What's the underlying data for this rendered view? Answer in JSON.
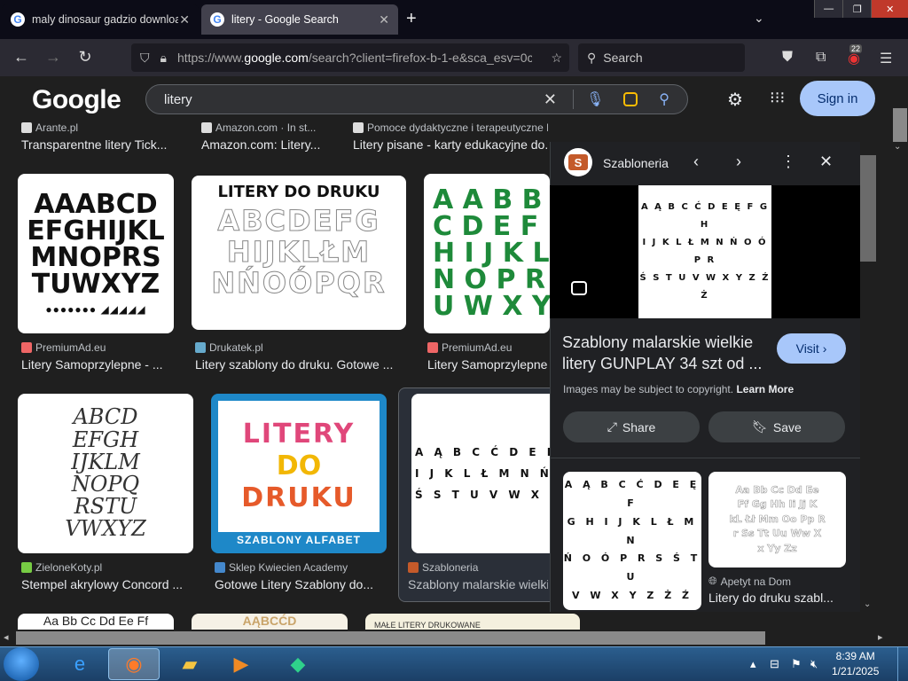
{
  "browser": {
    "tabs": [
      {
        "label": "maly dinosaur gadzio downloa",
        "active": false
      },
      {
        "label": "litery - Google Search",
        "active": true
      }
    ],
    "url_prefix": "https://www.",
    "url_domain": "google.com",
    "url_rest": "/search?client=firefox-b-1-e&sca_esv=0c",
    "search_placeholder": "Search",
    "badge": "22"
  },
  "google": {
    "logo": "Google",
    "query": "litery",
    "signin_label": "Sign in"
  },
  "top_row": [
    {
      "source": "Arante.pl",
      "title": "Transparentne litery Tick..."
    },
    {
      "source": "Amazon.com · In st...",
      "title": "Amazon.com: Litery..."
    },
    {
      "source": "Pomoce dydaktyczne i terapeutyczne By...",
      "title": "Litery pisane - karty edukacyjne do..."
    }
  ],
  "row1": [
    {
      "source": "PremiumAd.eu",
      "title": "Litery Samoprzylepne - ...",
      "art": [
        "AAABCD",
        "EFGHIJKL",
        "MNOPRS",
        "TUWXYZ"
      ]
    },
    {
      "source": "Drukatek.pl",
      "title": "Litery szablony do druku. Gotowe ...",
      "art_title": "LITERY DO DRUKU",
      "art": [
        "ABCDEFG",
        "HIJKLŁM",
        "NŃOÓPQR"
      ]
    },
    {
      "source": "PremiumAd.eu",
      "title": "Litery Samoprzylepne - ...",
      "art": [
        "A A B B",
        "C D E F",
        "H I J K L",
        "N O P R S",
        "U W X Y"
      ]
    }
  ],
  "row2": [
    {
      "source": "ZieloneKoty.pl",
      "title": "Stempel akrylowy Concord ...",
      "art": [
        "ABCD",
        "EFGH",
        "IJKLM",
        "NOPQ",
        "RSTU",
        "VWXYZ"
      ]
    },
    {
      "source": "Sklep Kwiecien Academy",
      "title": "Gotowe Litery Szablony do...",
      "art": [
        "LITERY",
        "DO",
        "DRUKU"
      ],
      "banner": "SZABLONY ALFABET"
    },
    {
      "source": "Szabloneria",
      "title": "Szablony malarskie wielkie...",
      "art": [
        "A Ą B C Ć D E Ę F G",
        "I J K L Ł M N Ń O Ó",
        "Ś S T U V W X Y Z Ż"
      ]
    }
  ],
  "row3": [
    {
      "art": "Aa Bb Cc Dd Ee Ff"
    },
    {
      "art": "AĄBCĆD"
    },
    {
      "art": "MAŁE LITERY DRUKOWANE"
    }
  ],
  "panel": {
    "site": "Szabloneria",
    "logo_letter": "S",
    "title": "Szablony malarskie wielkie litery GUNPLAY 34 szt od ...",
    "visit_label": "Visit",
    "copyright": "Images may be subject to copyright.",
    "learn_more": "Learn More",
    "share_label": "Share",
    "save_label": "Save",
    "preview_art": [
      "A Ą B C Ć D E Ę F G H",
      "I J K L Ł M N Ń O Ó P R",
      "Ś S T U V W X Y Z Ź Ż"
    ],
    "related": [
      {
        "art": [
          "A Ą B C Ć D E Ę F",
          "G H I J K L Ł M N",
          "Ń O Ó P R S Ś T U",
          "V W X Y Z Ż Ź"
        ]
      },
      {
        "source": "Apetyt na Dom",
        "title": "Litery do druku szabl...",
        "art": [
          "Aa Bb Cc Dd Ee",
          "Ff Gg Hh Ii Jj K",
          "kL Łł Mm Oo Pp R",
          "r Ss Tt Uu Ww X",
          "x Yy Zz"
        ]
      }
    ]
  },
  "taskbar": {
    "time": "8:39 AM",
    "date": "1/21/2025"
  }
}
